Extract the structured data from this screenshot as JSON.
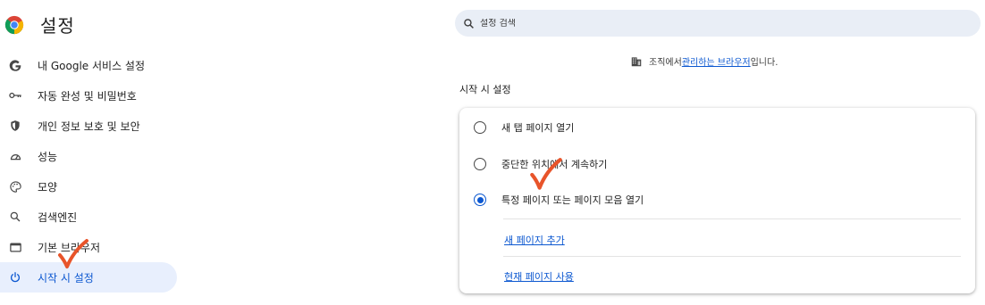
{
  "sidebar": {
    "title": "설정",
    "items": [
      {
        "label": "내 Google 서비스 설정",
        "icon": "google-icon"
      },
      {
        "label": "자동 완성 및 비밀번호",
        "icon": "key-icon"
      },
      {
        "label": "개인 정보 보호 및 보안",
        "icon": "shield-icon"
      },
      {
        "label": "성능",
        "icon": "speedometer-icon"
      },
      {
        "label": "모양",
        "icon": "palette-icon"
      },
      {
        "label": "검색엔진",
        "icon": "search-icon"
      },
      {
        "label": "기본 브라우저",
        "icon": "browser-window-icon"
      },
      {
        "label": "시작 시 설정",
        "icon": "power-icon",
        "active": true
      }
    ]
  },
  "search": {
    "placeholder": "설정 검색"
  },
  "managed_notice": {
    "prefix": "조직에서 ",
    "link": "관리하는 브라우저",
    "suffix": "입니다."
  },
  "startup": {
    "section_title": "시작 시 설정",
    "options": [
      {
        "label": "새 탭 페이지 열기",
        "selected": false
      },
      {
        "label": "중단한 위치에서 계속하기",
        "selected": false
      },
      {
        "label": "특정 페이지 또는 페이지 모음 열기",
        "selected": true
      }
    ],
    "add_page_link": "새 페이지 추가",
    "use_current_link": "현재 페이지 사용"
  },
  "colors": {
    "accent": "#0b57d0",
    "active_bg": "#e8effd",
    "search_bg": "#e9eef6",
    "annotation_check": "#e8542a"
  }
}
